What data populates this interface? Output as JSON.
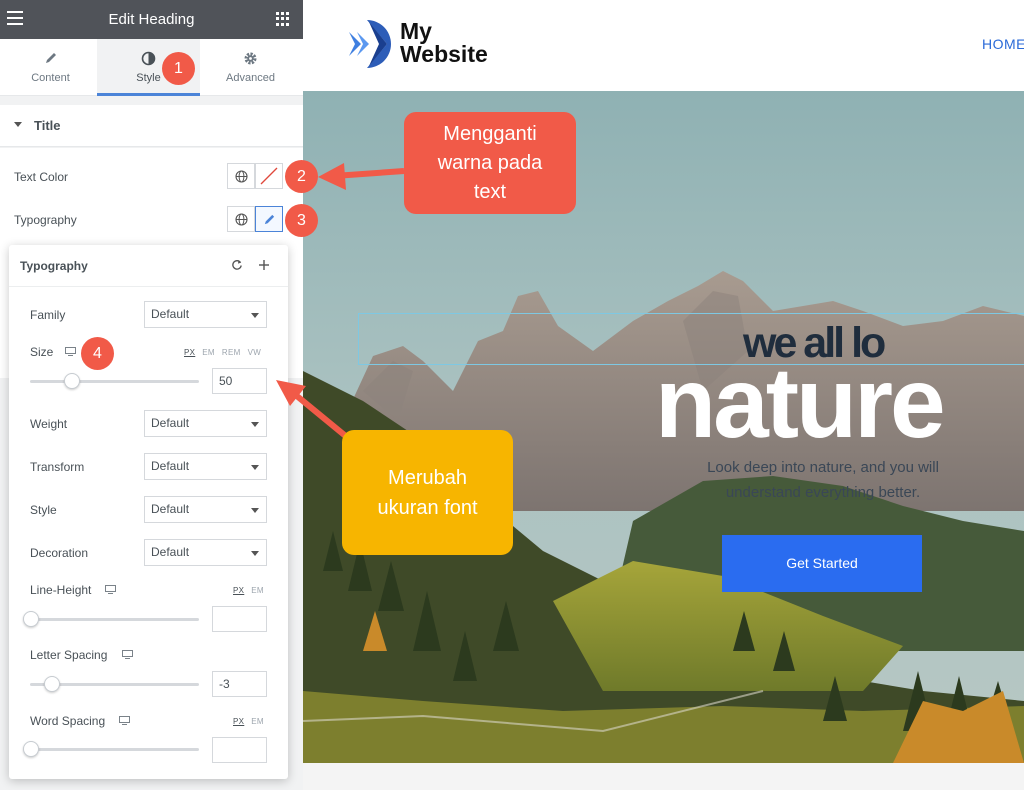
{
  "panel": {
    "title": "Edit Heading",
    "tabs": [
      {
        "label": "Content",
        "icon": "pencil-icon"
      },
      {
        "label": "Style",
        "icon": "half-circle-icon",
        "active": true
      },
      {
        "label": "Advanced",
        "icon": "gear-icon"
      }
    ],
    "section_title": "Title",
    "controls": {
      "text_color_label": "Text Color",
      "typography_label": "Typography"
    },
    "collapse_glyph": "‹"
  },
  "typography": {
    "title": "Typography",
    "family": {
      "label": "Family",
      "value": "Default"
    },
    "size": {
      "label": "Size",
      "units": [
        "PX",
        "EM",
        "REM",
        "VW"
      ],
      "active_unit": "PX",
      "value": "50",
      "slider_fraction": 0.25
    },
    "weight": {
      "label": "Weight",
      "value": "Default"
    },
    "transform": {
      "label": "Transform",
      "value": "Default"
    },
    "style": {
      "label": "Style",
      "value": "Default"
    },
    "decoration": {
      "label": "Decoration",
      "value": "Default"
    },
    "line_height": {
      "label": "Line-Height",
      "units": [
        "PX",
        "EM"
      ],
      "active_unit": "PX",
      "value": ""
    },
    "letter_spacing": {
      "label": "Letter Spacing",
      "value": "-3"
    },
    "word_spacing": {
      "label": "Word Spacing",
      "units": [
        "PX",
        "EM"
      ],
      "active_unit": "PX",
      "value": ""
    }
  },
  "site": {
    "logo_line1": "My",
    "logo_line2": "Website",
    "nav_home": "HOME",
    "hero": {
      "heading_small": "we all lo",
      "heading_big": "nature",
      "subtitle": "Look deep into nature, and you will understand everything better.",
      "cta": "Get Started"
    }
  },
  "annotations": {
    "badges": [
      "1",
      "2",
      "3",
      "4"
    ],
    "callout_color": "Mengganti warna pada text",
    "callout_font": "Merubah ukuran font",
    "colors": {
      "badge": "#f15a48",
      "callout_color": "#f15a48",
      "callout_font": "#f7b500"
    }
  },
  "colors": {
    "accent": "#4b84d8",
    "button": "#2a6cf0",
    "header_bar": "#505359"
  }
}
